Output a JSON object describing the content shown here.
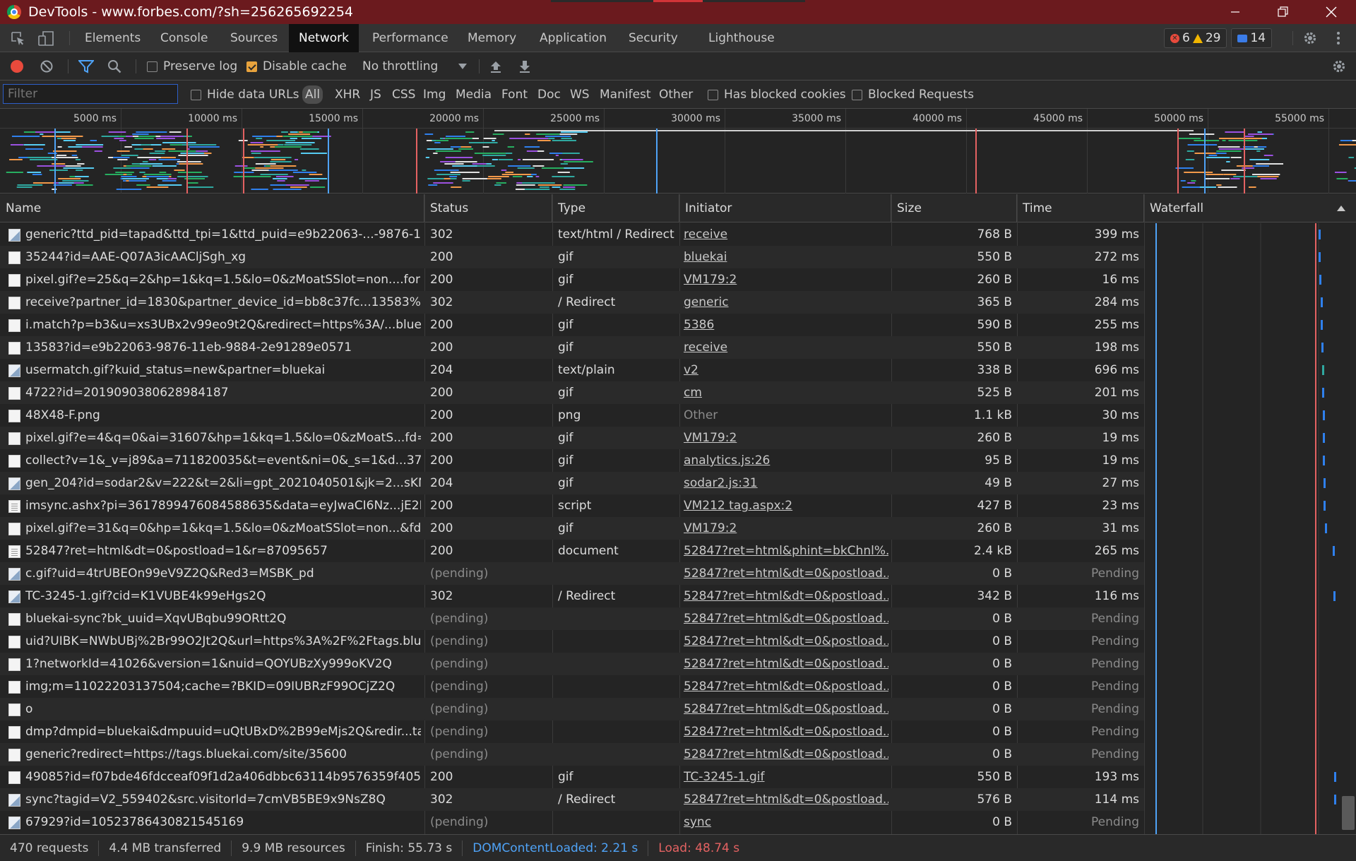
{
  "window": {
    "title": "DevTools - www.forbes.com/?sh=256265692254"
  },
  "tabs": [
    "Elements",
    "Console",
    "Sources",
    "Network",
    "Performance",
    "Memory",
    "Application",
    "Security",
    "Lighthouse"
  ],
  "active_tab": "Network",
  "counters": {
    "errors": "6",
    "warnings": "29",
    "messages": "14"
  },
  "toolbar": {
    "preserve_log": "Preserve log",
    "disable_cache": "Disable cache",
    "throttling": "No throttling"
  },
  "filterbar": {
    "placeholder": "Filter",
    "hide_data_urls": "Hide data URLs",
    "types": [
      "All",
      "XHR",
      "JS",
      "CSS",
      "Img",
      "Media",
      "Font",
      "Doc",
      "WS",
      "Manifest",
      "Other"
    ],
    "has_blocked_cookies": "Has blocked cookies",
    "blocked_requests": "Blocked Requests"
  },
  "overview": {
    "ticks": [
      "5000 ms",
      "10000 ms",
      "15000 ms",
      "20000 ms",
      "25000 ms",
      "30000 ms",
      "35000 ms",
      "40000 ms",
      "45000 ms",
      "50000 ms",
      "55000 ms"
    ]
  },
  "columns": {
    "name": "Name",
    "status": "Status",
    "type": "Type",
    "initiator": "Initiator",
    "size": "Size",
    "time": "Time",
    "waterfall": "Waterfall"
  },
  "requests": [
    {
      "name": "generic?ttd_pid=tapad&ttd_tpi=1&ttd_puid=e9b22063-...-9876-11e...",
      "status": "302",
      "type": "text/html / Redirect",
      "initiator": "receive",
      "size": "768 B",
      "time": "399 ms",
      "icon": "img"
    },
    {
      "name": "35244?id=AAE-Q07A3icAACljSgh_xg",
      "status": "200",
      "type": "gif",
      "initiator": "bluekai",
      "size": "550 B",
      "time": "272 ms",
      "icon": "blank"
    },
    {
      "name": "pixel.gif?e=25&q=2&hp=1&kq=1.5&lo=0&zMoatSSlot=non....forbe...",
      "status": "200",
      "type": "gif",
      "initiator": "VM179:2",
      "size": "260 B",
      "time": "16 ms",
      "icon": "blank"
    },
    {
      "name": "receive?partner_id=1830&partner_device_id=bb8c37fc...13583%3Fid...",
      "status": "302",
      "type": "/ Redirect",
      "initiator": "generic",
      "size": "365 B",
      "time": "284 ms",
      "icon": "blank"
    },
    {
      "name": "i.match?p=b3&u=xs3UBx2v99eo9t2Q&redirect=https%3A/...bluekai....",
      "status": "200",
      "type": "gif",
      "initiator": "5386",
      "size": "590 B",
      "time": "255 ms",
      "icon": "blank"
    },
    {
      "name": "13583?id=e9b22063-9876-11eb-9884-2e91289e0571",
      "status": "200",
      "type": "gif",
      "initiator": "receive",
      "size": "550 B",
      "time": "198 ms",
      "icon": "blank"
    },
    {
      "name": "usermatch.gif?kuid_status=new&partner=bluekai",
      "status": "204",
      "type": "text/plain",
      "initiator": "v2",
      "size": "338 B",
      "time": "696 ms",
      "icon": "img"
    },
    {
      "name": "4722?id=2019090380628984187",
      "status": "200",
      "type": "gif",
      "initiator": "cm",
      "size": "525 B",
      "time": "201 ms",
      "icon": "blank"
    },
    {
      "name": "48X48-F.png",
      "status": "200",
      "type": "png",
      "initiator": "Other",
      "size": "1.1 kB",
      "time": "30 ms",
      "icon": "blank"
    },
    {
      "name": "pixel.gif?e=4&q=0&ai=31607&hp=1&kq=1.5&lo=0&zMoatS...fd=1...",
      "status": "200",
      "type": "gif",
      "initiator": "VM179:2",
      "size": "260 B",
      "time": "19 ms",
      "icon": "blank"
    },
    {
      "name": "collect?v=1&_v=j89&a=711820035&t=event&ni=0&_s=1&d...37824...",
      "status": "200",
      "type": "gif",
      "initiator": "analytics.js:26",
      "size": "95 B",
      "time": "19 ms",
      "icon": "blank"
    },
    {
      "name": "gen_204?id=sodar2&v=222&t=2&li=gpt_2021040501&jk=2...sKNqq...",
      "status": "204",
      "type": "gif",
      "initiator": "sodar2.js:31",
      "size": "49 B",
      "time": "27 ms",
      "icon": "img"
    },
    {
      "name": "imsync.ashx?pi=3617899476084588635&data=eyJwaCI6Nz...jE2MTc...",
      "status": "200",
      "type": "script",
      "initiator": "VM212 tag.aspx:2",
      "size": "427 B",
      "time": "23 ms",
      "icon": "doc"
    },
    {
      "name": "pixel.gif?e=31&q=0&hp=1&kq=1.5&lo=0&zMoatSSlot=non...&fd=...",
      "status": "200",
      "type": "gif",
      "initiator": "VM179:2",
      "size": "260 B",
      "time": "31 ms",
      "icon": "blank"
    },
    {
      "name": "52847?ret=html&dt=0&postload=1&r=87095657",
      "status": "200",
      "type": "document",
      "initiator": "52847?ret=html&phint=bkChnl%...",
      "size": "2.4 kB",
      "time": "265 ms",
      "icon": "doc"
    },
    {
      "name": "c.gif?uid=4trUBEOn99eV9Z2Q&Red3=MSBK_pd",
      "status": "(pending)",
      "type": "",
      "initiator": "52847?ret=html&dt=0&postload...",
      "size": "0 B",
      "time": "Pending",
      "icon": "img"
    },
    {
      "name": "TC-3245-1.gif?cid=K1VUBE4k99eHgs2Q",
      "status": "302",
      "type": "/ Redirect",
      "initiator": "52847?ret=html&dt=0&postload...",
      "size": "342 B",
      "time": "116 ms",
      "icon": "img"
    },
    {
      "name": "bluekai-sync?bk_uuid=XqvUBqbu99ORtt2Q",
      "status": "(pending)",
      "type": "",
      "initiator": "52847?ret=html&dt=0&postload...",
      "size": "0 B",
      "time": "Pending",
      "icon": "blank"
    },
    {
      "name": "uid?UIBK=NWbUBj%2Br99O2Jt2Q&url=https%3A%2F%2Ftags.bluek...",
      "status": "(pending)",
      "type": "",
      "initiator": "52847?ret=html&dt=0&postload...",
      "size": "0 B",
      "time": "Pending",
      "icon": "blank"
    },
    {
      "name": "1?networkId=41026&version=1&nuid=QOYUBzXy999oKV2Q",
      "status": "(pending)",
      "type": "",
      "initiator": "52847?ret=html&dt=0&postload...",
      "size": "0 B",
      "time": "Pending",
      "icon": "blank"
    },
    {
      "name": "img;m=11022203137504;cache=?BKID=09IUBRzF99OCjZ2Q",
      "status": "(pending)",
      "type": "",
      "initiator": "52847?ret=html&dt=0&postload...",
      "size": "0 B",
      "time": "Pending",
      "icon": "blank"
    },
    {
      "name": "o",
      "status": "(pending)",
      "type": "",
      "initiator": "52847?ret=html&dt=0&postload...",
      "size": "0 B",
      "time": "Pending",
      "icon": "blank"
    },
    {
      "name": "dmp?dmpid=bluekai&dmpuuid=uQtUBxD%2B99eMjs2Q&redir...tag...",
      "status": "(pending)",
      "type": "",
      "initiator": "52847?ret=html&dt=0&postload...",
      "size": "0 B",
      "time": "Pending",
      "icon": "blank"
    },
    {
      "name": "generic?redirect=https://tags.bluekai.com/site/35600",
      "status": "(pending)",
      "type": "",
      "initiator": "52847?ret=html&dt=0&postload...",
      "size": "0 B",
      "time": "Pending",
      "icon": "blank"
    },
    {
      "name": "49085?id=f07bde46fdcceaf09f1d2a406dbbc63114b9576359f405253...",
      "status": "200",
      "type": "gif",
      "initiator": "TC-3245-1.gif",
      "size": "550 B",
      "time": "193 ms",
      "icon": "blank"
    },
    {
      "name": "sync?tagid=V2_559402&src.visitorId=7cmVB5BE9x9NsZ8Q",
      "status": "302",
      "type": "/ Redirect",
      "initiator": "52847?ret=html&dt=0&postload...",
      "size": "576 B",
      "time": "114 ms",
      "icon": "img"
    },
    {
      "name": "67929?id=10523786430821545169",
      "status": "(pending)",
      "type": "",
      "initiator": "sync",
      "size": "0 B",
      "time": "Pending",
      "icon": "img"
    }
  ],
  "status_bar": {
    "requests": "470 requests",
    "transferred": "4.4 MB transferred",
    "resources": "9.9 MB resources",
    "finish": "Finish: 55.73 s",
    "dom_content_loaded": "DOMContentLoaded: 2.21 s",
    "load": "Load: 48.74 s"
  },
  "colors": {
    "accent": "#4fa3f7",
    "load_line": "#e46262",
    "dom_line": "#4fa3f7",
    "titlebar": "#6b1a1e"
  }
}
